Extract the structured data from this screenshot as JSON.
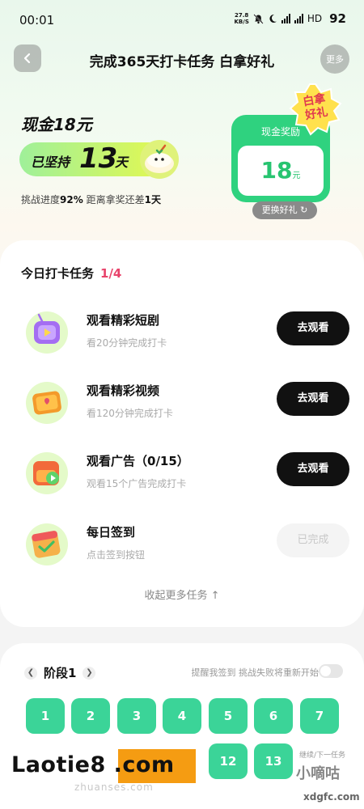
{
  "status_bar": {
    "time": "00:01",
    "net_speed_value": "27.8",
    "net_speed_unit": "KB/S",
    "network": "HD",
    "battery": "92"
  },
  "nav": {
    "title": "完成365天打卡任务 白拿好礼",
    "more_label": "更多"
  },
  "hero": {
    "cash_title": "现金18元",
    "streak_prefix": "已坚持",
    "streak_days": "13",
    "streak_suffix": "天",
    "progress_label": "挑战进度",
    "progress_value": "92%",
    "remaining_label": "距离拿奖还差",
    "remaining_value": "1天",
    "reward_label": "现金奖励",
    "reward_amount": "18",
    "reward_unit": "元",
    "gift_badge_line1": "白拿",
    "gift_badge_line2": "好礼",
    "change_gift_label": "更换好礼 ↻"
  },
  "tasks": {
    "header": "今日打卡任务",
    "count": "1/4",
    "items": [
      {
        "title": "观看精彩短剧",
        "subtitle": "看20分钟完成打卡",
        "button": "去观看",
        "icon": "short-drama-tv-icon"
      },
      {
        "title": "观看精彩视频",
        "subtitle": "看120分钟完成打卡",
        "button": "去观看",
        "icon": "video-play-icon"
      },
      {
        "title": "观看广告（0/15）",
        "subtitle": "观看15个广告完成打卡",
        "button": "去观看",
        "icon": "ad-video-icon"
      },
      {
        "title": "每日签到",
        "subtitle": "点击签到按钮",
        "button": "已完成",
        "icon": "calendar-check-icon"
      }
    ],
    "collapse_label": "收起更多任务 ↑"
  },
  "stage": {
    "title": "阶段1",
    "remind_label": "提醒我签到 挑战失败将重新开始",
    "remind_enabled": false,
    "days": [
      "1",
      "2",
      "3",
      "4",
      "5",
      "6",
      "7",
      "12",
      "13"
    ]
  },
  "watermarks": {
    "main": "Laotie8 .com",
    "main_sub": "zhuanses.com",
    "side": "小嘀咕",
    "side_sub": "继续/下一任务",
    "side_bottom": "xdgfc.com"
  },
  "colors": {
    "accent_green": "#2fd27f",
    "tile_green": "#3bd498",
    "count_pink": "#e8436b",
    "button_black": "#111111"
  }
}
